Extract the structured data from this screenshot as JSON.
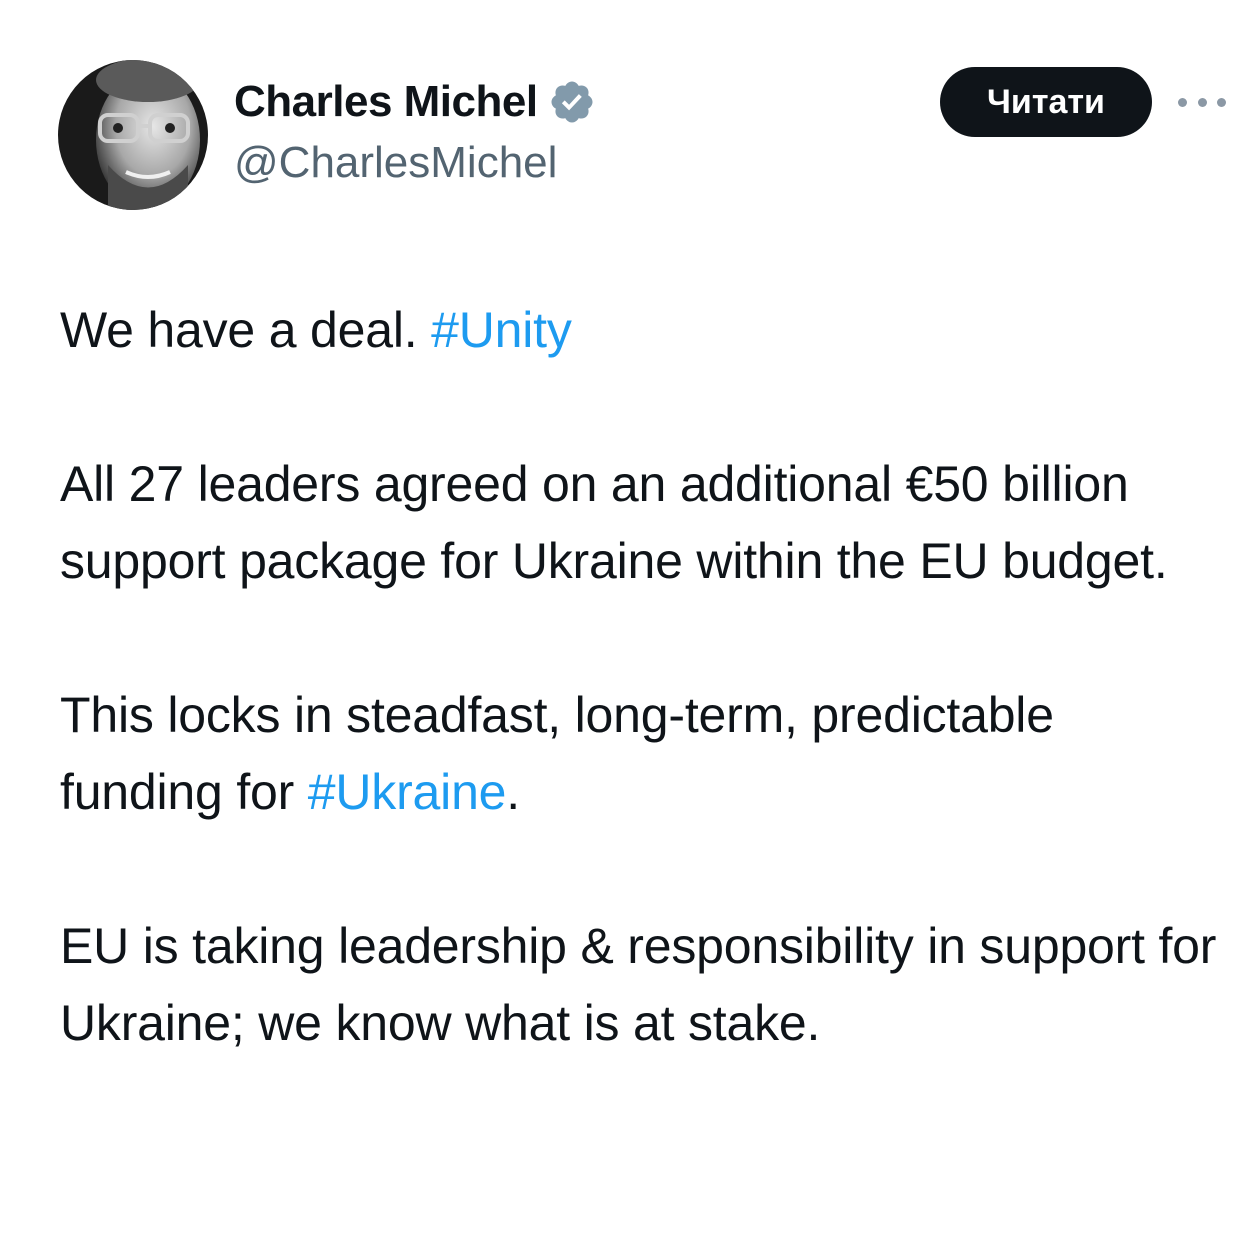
{
  "author": {
    "display_name": "Charles Michel",
    "handle": "@CharlesMichel",
    "verified_icon": "verified-badge-icon",
    "badge_color": "#829aab"
  },
  "actions": {
    "follow_label": "Читати",
    "more_icon": "more-horizontal-icon"
  },
  "tweet": {
    "p1": {
      "text": "We have a deal. ",
      "hashtag": "#Unity"
    },
    "p2": {
      "text": "All 27 leaders agreed on an additional €50 billion support package for Ukraine within the EU budget."
    },
    "p3": {
      "text": "This locks in steadfast, long-term, predictable funding for ",
      "hashtag": "#Ukraine",
      "suffix": "."
    },
    "p4": {
      "text": "EU is taking leadership & responsibility in support for Ukraine; we know what is at stake."
    }
  },
  "colors": {
    "text": "#0f1419",
    "secondary": "#536471",
    "link": "#1d9bf0",
    "button_bg": "#0f1419"
  }
}
